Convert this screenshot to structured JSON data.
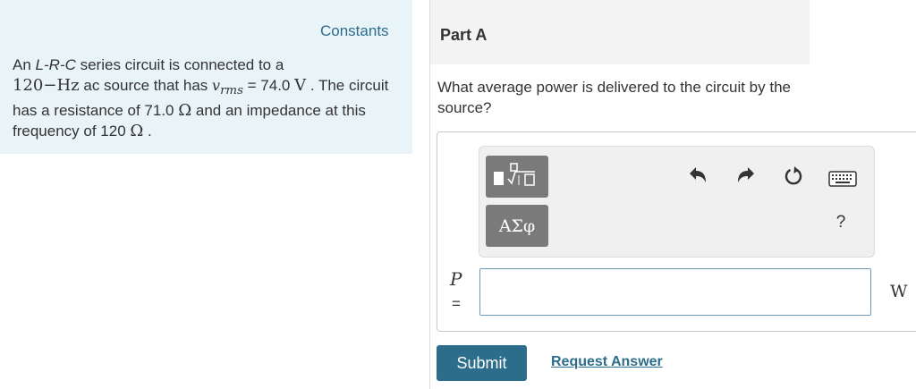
{
  "left_panel": {
    "constants_label": "Constants",
    "problem": {
      "t1": "An ",
      "circuit_type": "L-R-C",
      "t2": " series circuit is connected to a",
      "freq_value": "120",
      "dash": "−",
      "freq_unit": "Hz",
      "t3": " ac source that has ",
      "v_symbol": "v",
      "v_sub": "rms",
      "t4": " = 74.0 ",
      "volt_unit": "V",
      "t5": " . The circuit has a resistance of 71.0 ",
      "ohm1": "Ω",
      "t6": " and an impedance at this frequency of 120 ",
      "ohm2": "Ω",
      "t7": " ."
    }
  },
  "part": {
    "title": "Part A",
    "question": "What average power is delivered to the circuit by the source?"
  },
  "toolbar": {
    "greek_label": "ΑΣφ",
    "help_label": "?",
    "icons": [
      "templates-icon",
      "undo-icon",
      "redo-icon",
      "reset-icon",
      "keyboard-icon"
    ]
  },
  "answer": {
    "variable": "P",
    "equals": "=",
    "value": "",
    "unit": "W"
  },
  "actions": {
    "submit_label": "Submit",
    "request_label": "Request Answer"
  },
  "colors": {
    "accent": "#2d6d8c",
    "panel_bg": "#e8f4f8",
    "toolbar_btn": "#7a7a7a"
  }
}
